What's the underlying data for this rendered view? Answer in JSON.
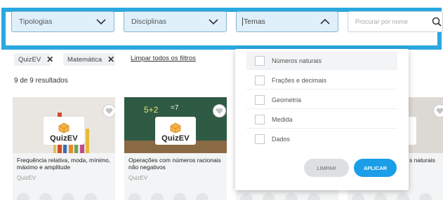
{
  "filters": {
    "tipologias": {
      "label": "Tipologias",
      "icon": "chevron-down-icon"
    },
    "disciplinas": {
      "label": "Disciplinas",
      "icon": "chevron-down-icon"
    },
    "temas": {
      "label": "Temas",
      "icon": "chevron-up-icon"
    },
    "search": {
      "placeholder": "Procurar por nome",
      "icon": "search-icon"
    },
    "accent_color": "#2aa8e0"
  },
  "chips": [
    {
      "label": "QuizEV"
    },
    {
      "label": "Matemática"
    }
  ],
  "clear_all": "Limpar todos os filtros",
  "results_text": "9 de 9 resultados",
  "cards": [
    {
      "title": "Frequência relativa, moda, mínimo, máximo e amplitude",
      "type": "QuizEV",
      "brand": "QuizEV"
    },
    {
      "title": "Operações com números racionais não negativos",
      "type": "QuizEV",
      "brand": "QuizEV"
    },
    {
      "title": "",
      "type": "",
      "brand": ""
    },
    {
      "title": "s naturais",
      "type": "",
      "brand": "V"
    }
  ],
  "dropdown": {
    "items": [
      {
        "label": "Números naturais"
      },
      {
        "label": "Frações e decimais"
      },
      {
        "label": "Geometria"
      },
      {
        "label": "Medida"
      },
      {
        "label": "Dados"
      }
    ],
    "limpar": "LIMPAR",
    "aplicar": "APLICAR",
    "aplicar_color": "#1a9ee8"
  }
}
